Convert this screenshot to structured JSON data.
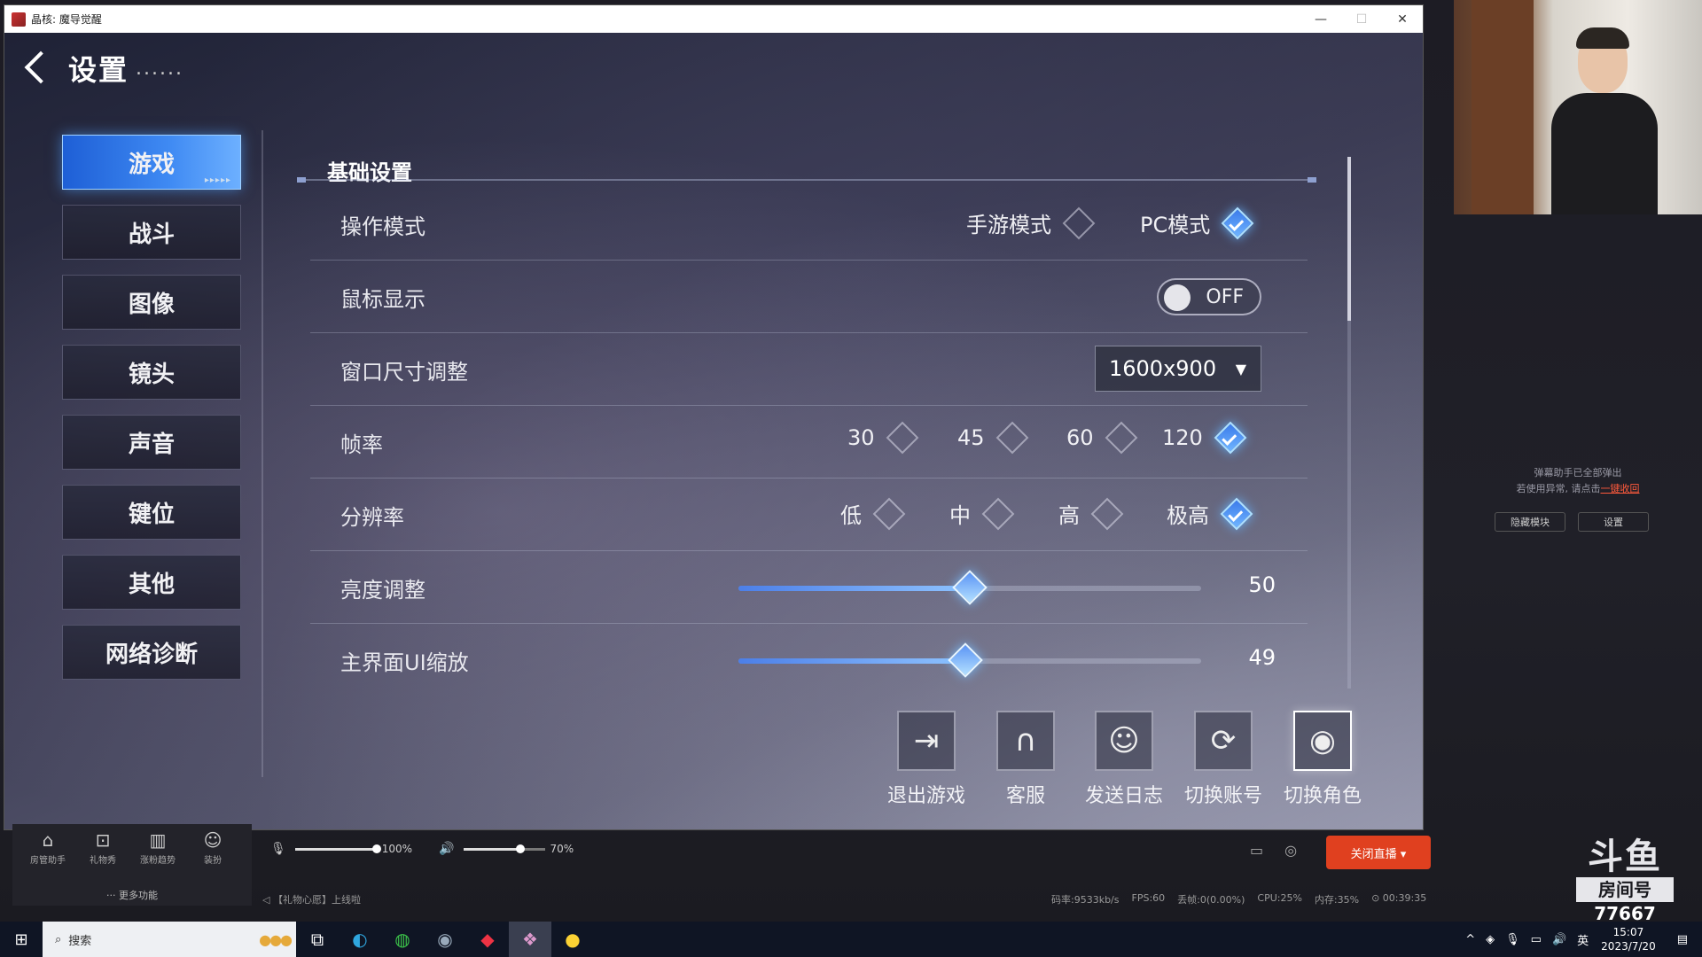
{
  "window": {
    "title": "晶核: 魔导觉醒",
    "controls": {
      "minimize": "—",
      "maximize": "☐",
      "close": "✕"
    }
  },
  "settings": {
    "header_title": "设置",
    "header_dots": "......",
    "nav": [
      {
        "label": "游戏",
        "active": true
      },
      {
        "label": "战斗"
      },
      {
        "label": "图像"
      },
      {
        "label": "镜头"
      },
      {
        "label": "声音"
      },
      {
        "label": "键位"
      },
      {
        "label": "其他"
      },
      {
        "label": "网络诊断"
      }
    ],
    "section_title": "基础设置",
    "operation_mode": {
      "label": "操作模式",
      "options": [
        "手游模式",
        "PC模式"
      ],
      "selected": "PC模式"
    },
    "mouse_display": {
      "label": "鼠标显示",
      "state": "OFF"
    },
    "window_size": {
      "label": "窗口尺寸调整",
      "value": "1600x900",
      "arrow": "▼"
    },
    "frame_rate": {
      "label": "帧率",
      "options": [
        "30",
        "45",
        "60",
        "120"
      ],
      "selected": "120"
    },
    "resolution": {
      "label": "分辨率",
      "options": [
        "低",
        "中",
        "高",
        "极高"
      ],
      "selected": "极高"
    },
    "brightness": {
      "label": "亮度调整",
      "value": "50",
      "fraction": 0.5
    },
    "ui_scale": {
      "label": "主界面UI缩放",
      "value": "49",
      "fraction": 0.49
    },
    "actions": [
      {
        "label": "退出游戏",
        "icon": "exit-icon"
      },
      {
        "label": "客服",
        "icon": "headset-icon"
      },
      {
        "label": "发送日志",
        "icon": "log-icon"
      },
      {
        "label": "切换账号",
        "icon": "switch-account-icon"
      },
      {
        "label": "切换角色",
        "icon": "switch-role-icon"
      }
    ]
  },
  "stream": {
    "danmu_notice_line1": "弹幕助手已全部弹出",
    "danmu_notice_line2": "若使用异常, 请点击",
    "danmu_notice_link": "一键收回",
    "hide_module": "隐藏模块",
    "settings": "设置",
    "room_brand": "斗鱼",
    "room_label": "房间号",
    "room_number": "77667",
    "tools": [
      {
        "label": "房管助手",
        "icon": "house-icon"
      },
      {
        "label": "礼物秀",
        "icon": "gift-icon"
      },
      {
        "label": "涨粉趋势",
        "icon": "chart-icon"
      },
      {
        "label": "装扮",
        "icon": "face-icon"
      }
    ],
    "more_functions": "··· 更多功能",
    "mic_volume": "100%",
    "speaker_volume": "70%",
    "mic_fraction": 1.0,
    "speaker_fraction": 0.7,
    "close_live": "关闭直播 ▾",
    "status_left": "【礼物心愿】上线啦",
    "bitrate": "码率:9533kb/s",
    "fps": "FPS:60",
    "drop": "丢帧:0(0.00%)",
    "cpu": "CPU:25%",
    "mem": "内存:35%",
    "duration": "⊙ 00:39:35"
  },
  "taskbar": {
    "search_placeholder": "搜索",
    "ime": "英",
    "time": "15:07",
    "date": "2023/7/20"
  }
}
